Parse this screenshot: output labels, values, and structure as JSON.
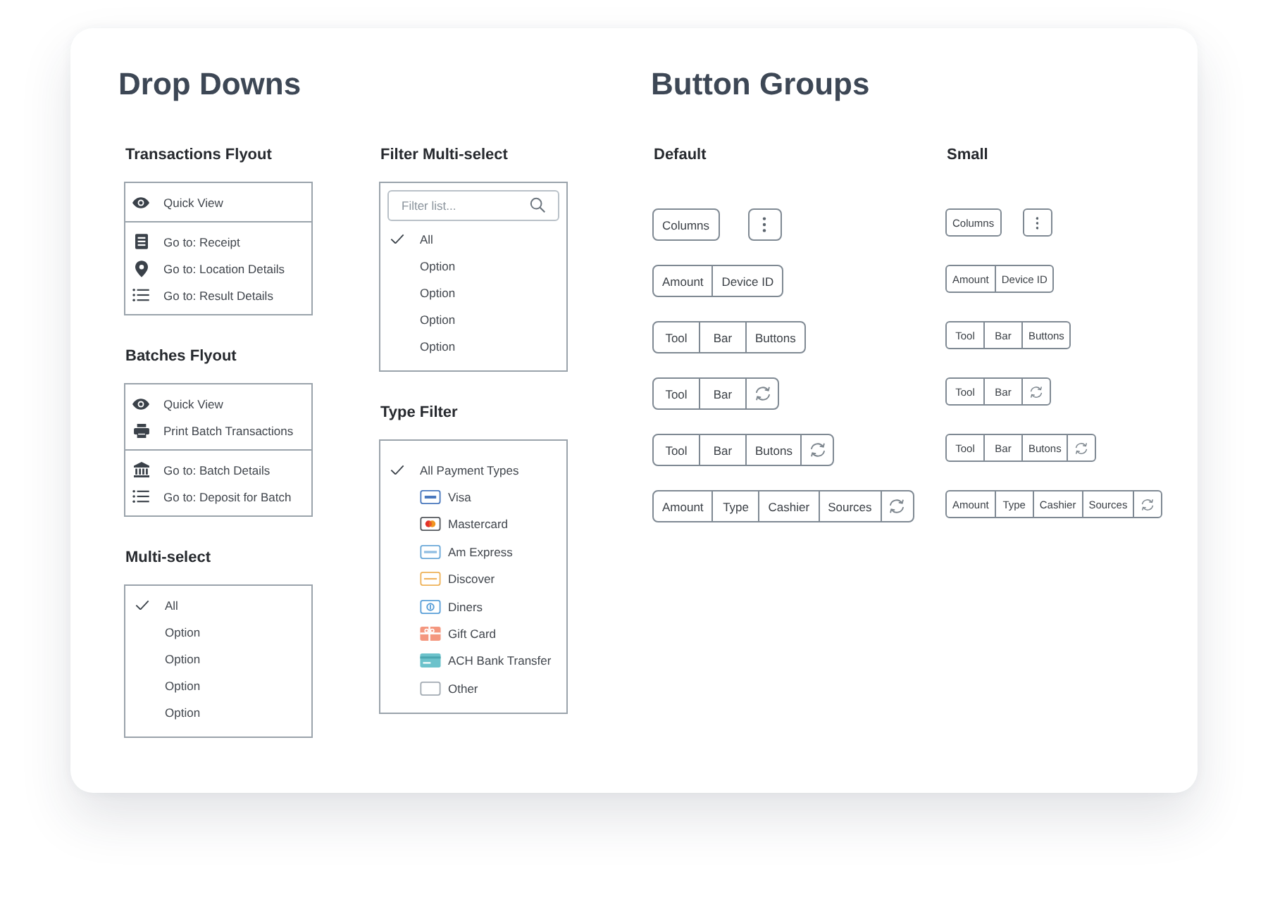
{
  "drop_downs": {
    "title": "Drop Downs",
    "columns": [
      [
        {
          "kind": "flyout",
          "title": "Transactions Flyout",
          "groups": [
            [
              {
                "kind": "view",
                "label": "Quick View"
              }
            ],
            [
              {
                "kind": "receipt",
                "label": "Go to: Receipt"
              },
              {
                "kind": "location",
                "label": "Go to: Location Details"
              },
              {
                "kind": "results",
                "label": "Go to: Result Details"
              }
            ]
          ]
        },
        {
          "kind": "flyout",
          "title": "Batches Flyout",
          "groups": [
            [
              {
                "kind": "view",
                "label": "Quick View"
              },
              {
                "kind": "print",
                "label": "Print Batch Transactions"
              }
            ],
            [
              {
                "kind": "batch",
                "label": "Go to: Batch Details"
              },
              {
                "kind": "deposit",
                "label": "Go to: Deposit for Batch"
              }
            ]
          ]
        },
        {
          "kind": "multiselect",
          "title": "Multi-select",
          "options": [
            {
              "label": "All",
              "checked": true
            },
            {
              "label": "Option",
              "checked": false
            },
            {
              "label": "Option",
              "checked": false
            },
            {
              "label": "Option",
              "checked": false
            },
            {
              "label": "Option",
              "checked": false
            }
          ]
        }
      ],
      [
        {
          "kind": "multiselect",
          "title": "Filter Multi-select",
          "filter": {
            "placeholder": "Filter list..."
          },
          "options": [
            {
              "label": "All",
              "checked": true
            },
            {
              "label": "Option",
              "checked": false
            },
            {
              "label": "Option",
              "checked": false
            },
            {
              "label": "Option",
              "checked": false
            },
            {
              "label": "Option",
              "checked": false
            }
          ]
        },
        {
          "kind": "typefilter",
          "title": "Type Filter",
          "options": [
            {
              "kind": "all",
              "label": "All Payment Types",
              "checked": true
            },
            {
              "kind": "visa",
              "label": "Visa",
              "checked": false
            },
            {
              "kind": "mastercard",
              "label": "Mastercard",
              "checked": false
            },
            {
              "kind": "amex",
              "label": "Am Express",
              "checked": false
            },
            {
              "kind": "discover",
              "label": "Discover",
              "checked": false
            },
            {
              "kind": "diners",
              "label": "Diners",
              "checked": false
            },
            {
              "kind": "gift",
              "label": "Gift Card",
              "checked": false
            },
            {
              "kind": "ach",
              "label": "ACH Bank Transfer",
              "checked": false
            },
            {
              "kind": "other",
              "label": "Other",
              "checked": false
            }
          ]
        }
      ]
    ]
  },
  "button_groups": {
    "title": "Button Groups",
    "sets": [
      {
        "kind": "regular",
        "title": "Default",
        "rows": [
          [
            [
              {
                "kind": "label",
                "label": "Columns"
              }
            ],
            [
              {
                "kind": "more"
              }
            ]
          ],
          [
            [
              {
                "kind": "label",
                "label": "Amount"
              },
              {
                "kind": "label",
                "label": "Device ID"
              }
            ]
          ],
          [
            [
              {
                "kind": "label",
                "label": "Tool"
              },
              {
                "kind": "label",
                "label": "Bar"
              },
              {
                "kind": "label",
                "label": "Buttons"
              }
            ]
          ],
          [
            [
              {
                "kind": "label",
                "label": "Tool"
              },
              {
                "kind": "label",
                "label": "Bar"
              },
              {
                "kind": "refresh"
              }
            ]
          ],
          [
            [
              {
                "kind": "label",
                "label": "Tool"
              },
              {
                "kind": "label",
                "label": "Bar"
              },
              {
                "kind": "label",
                "label": "Butons"
              },
              {
                "kind": "refresh"
              }
            ]
          ],
          [
            [
              {
                "kind": "label",
                "label": "Amount"
              },
              {
                "kind": "label",
                "label": "Type"
              },
              {
                "kind": "label",
                "label": "Cashier"
              },
              {
                "kind": "label",
                "label": "Sources"
              },
              {
                "kind": "refresh"
              }
            ]
          ]
        ]
      },
      {
        "kind": "small",
        "title": "Small",
        "rows": [
          [
            [
              {
                "kind": "label",
                "label": "Columns"
              }
            ],
            [
              {
                "kind": "more"
              }
            ]
          ],
          [
            [
              {
                "kind": "label",
                "label": "Amount"
              },
              {
                "kind": "label",
                "label": "Device ID"
              }
            ]
          ],
          [
            [
              {
                "kind": "label",
                "label": "Tool"
              },
              {
                "kind": "label",
                "label": "Bar"
              },
              {
                "kind": "label",
                "label": "Buttons"
              }
            ]
          ],
          [
            [
              {
                "kind": "label",
                "label": "Tool"
              },
              {
                "kind": "label",
                "label": "Bar"
              },
              {
                "kind": "refresh"
              }
            ]
          ],
          [
            [
              {
                "kind": "label",
                "label": "Tool"
              },
              {
                "kind": "label",
                "label": "Bar"
              },
              {
                "kind": "label",
                "label": "Butons"
              },
              {
                "kind": "refresh"
              }
            ]
          ],
          [
            [
              {
                "kind": "label",
                "label": "Amount"
              },
              {
                "kind": "label",
                "label": "Type"
              },
              {
                "kind": "label",
                "label": "Cashier"
              },
              {
                "kind": "label",
                "label": "Sources"
              },
              {
                "kind": "refresh"
              }
            ]
          ]
        ]
      }
    ]
  }
}
